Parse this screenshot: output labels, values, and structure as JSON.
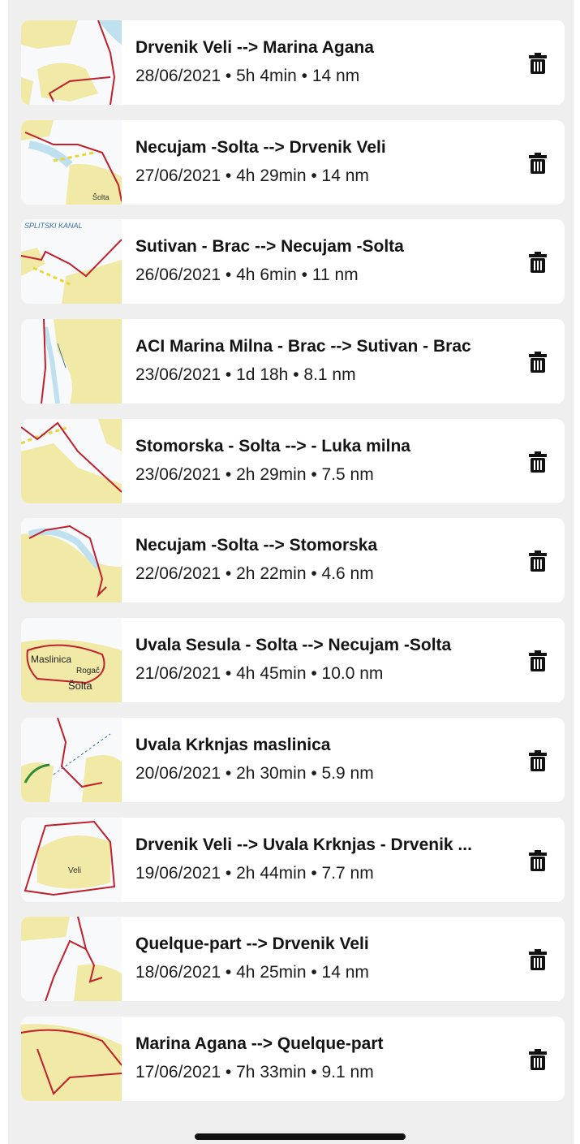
{
  "trips": [
    {
      "title": "Drvenik Veli --> Marina Agana",
      "meta": "28/06/2021 • 5h 4min • 14 nm"
    },
    {
      "title": "Necujam -Solta --> Drvenik Veli",
      "meta": "27/06/2021 • 4h 29min • 14 nm"
    },
    {
      "title": "Sutivan - Brac --> Necujam -Solta",
      "meta": "26/06/2021 • 4h 6min • 11 nm"
    },
    {
      "title": "ACI Marina Milna - Brac --> Sutivan - Brac",
      "meta": "23/06/2021 • 1d 18h • 8.1 nm"
    },
    {
      "title": "Stomorska - Solta --> - Luka milna",
      "meta": "23/06/2021 • 2h 29min • 7.5 nm"
    },
    {
      "title": "Necujam -Solta --> Stomorska",
      "meta": "22/06/2021 • 2h 22min • 4.6 nm"
    },
    {
      "title": "Uvala Sesula - Solta --> Necujam -Solta",
      "meta": "21/06/2021 • 4h 45min • 10.0 nm"
    },
    {
      "title": "Uvala Krknjas maslinica",
      "meta": "20/06/2021 • 2h 30min • 5.9 nm"
    },
    {
      "title": "Drvenik Veli --> Uvala Krknjas - Drvenik ...",
      "meta": "19/06/2021 • 2h 44min • 7.7 nm"
    },
    {
      "title": "Quelque-part --> Drvenik Veli",
      "meta": "18/06/2021 • 4h 25min • 14 nm"
    },
    {
      "title": "Marina Agana --> Quelque-part",
      "meta": "17/06/2021 • 7h 33min • 9.1 nm"
    }
  ],
  "map_labels": {
    "map_2": "Šolta",
    "map_3": "SPLITSKI KANAL",
    "map_7a": "Maslinica",
    "map_7b": "Rogač",
    "map_7c": "Šolta",
    "map_9": "Veli"
  },
  "colors": {
    "land": "#f1e9a6",
    "sea": "#f7f9fb",
    "shallow": "#bfe0ef",
    "route": "#c21f2c",
    "text": "#141414"
  },
  "icons": {
    "delete": "trash-icon",
    "map": "route-map-thumbnail"
  }
}
